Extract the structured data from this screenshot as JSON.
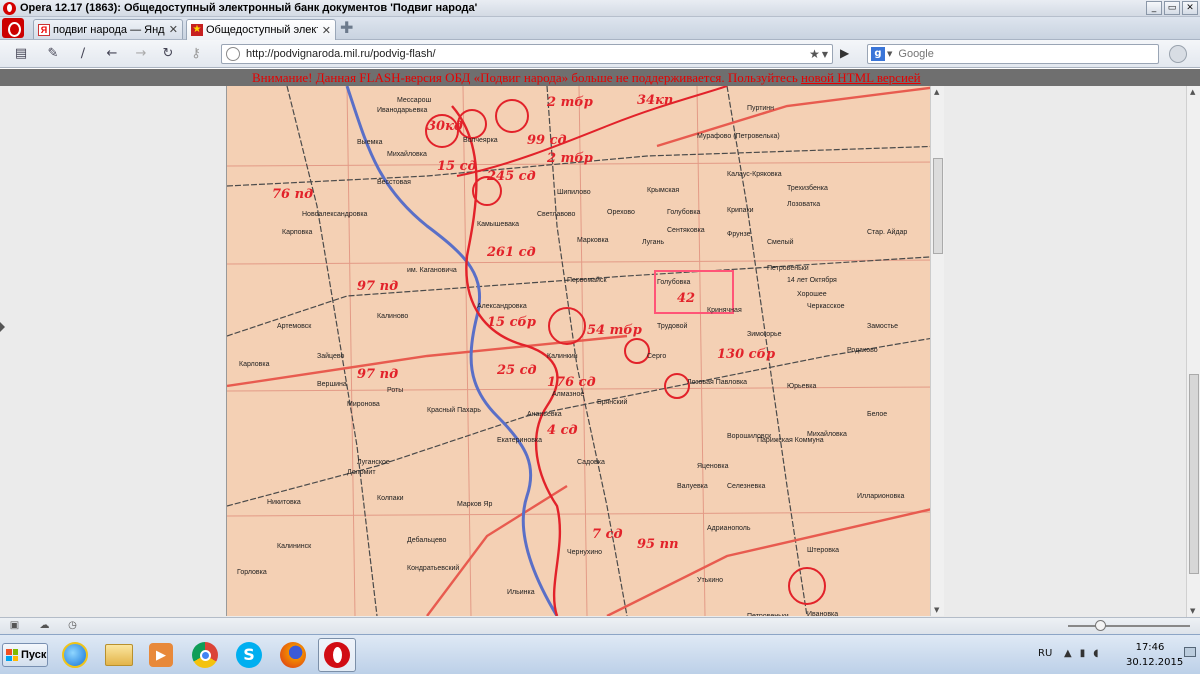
{
  "window": {
    "title": "Opera 12.17 (1863): Общедоступный электронный банк документов 'Подвиг народа'"
  },
  "tabs": [
    {
      "label": "подвиг народа — Янде...",
      "favicon": "yandex-icon",
      "active": false
    },
    {
      "label": "Общедоступный электр...",
      "favicon": "star-icon",
      "active": true
    }
  ],
  "toolbar": {
    "url": "http://podvignaroda.mil.ru/podvig-flash/",
    "search_placeholder": "Google"
  },
  "page": {
    "notice_text": "Внимание! Данная FLASH-версия ОБД «Подвиг народа» больше не поддерживается. Пользуйтесь ",
    "notice_link": "новой HTML версией"
  },
  "map": {
    "labels": [
      {
        "text": "Мессарош"
      },
      {
        "text": "Иванодарьевка"
      },
      {
        "text": "30кд"
      },
      {
        "text": "Волчеярка"
      },
      {
        "text": "2 тбр"
      },
      {
        "text": "34кп"
      },
      {
        "text": "Пуртинн"
      },
      {
        "text": "Выемка"
      },
      {
        "text": "99 сд"
      },
      {
        "text": "Мурафово (Петровелька)"
      },
      {
        "text": "Михайловка"
      },
      {
        "text": "15 сд"
      },
      {
        "text": "2 тбр"
      },
      {
        "text": "Калаус-Кряковка"
      },
      {
        "text": "76 пд"
      },
      {
        "text": "Весстовая"
      },
      {
        "text": "245 сд"
      },
      {
        "text": "Шипилово"
      },
      {
        "text": "Крымская"
      },
      {
        "text": "Трехизбенка"
      },
      {
        "text": "Новоалександровка"
      },
      {
        "text": "Светлавово"
      },
      {
        "text": "Орехово"
      },
      {
        "text": "Голубовка"
      },
      {
        "text": "Крипаки"
      },
      {
        "text": "Лозоватка"
      },
      {
        "text": "Стар. Айдар"
      },
      {
        "text": "Карповка"
      },
      {
        "text": "Камышевака"
      },
      {
        "text": "Марковка"
      },
      {
        "text": "Лугань"
      },
      {
        "text": "Сентяковка"
      },
      {
        "text": "Фрунзе"
      },
      {
        "text": "Смелый"
      },
      {
        "text": "261 сд"
      },
      {
        "text": "Первомайск"
      },
      {
        "text": "Голубовка"
      },
      {
        "text": "Петровеньки"
      },
      {
        "text": "14 лет Октября"
      },
      {
        "text": "им. Кагановича"
      },
      {
        "text": "97 пд"
      },
      {
        "text": "Александровка"
      },
      {
        "text": "42"
      },
      {
        "text": "Кринячная"
      },
      {
        "text": "Хорошее"
      },
      {
        "text": "Черкасское"
      },
      {
        "text": "Артемовск"
      },
      {
        "text": "Калиново"
      },
      {
        "text": "15 сбр"
      },
      {
        "text": "Трудовой"
      },
      {
        "text": "Замостье"
      },
      {
        "text": "Зимогорье"
      },
      {
        "text": "54 тбр"
      },
      {
        "text": "Калинкин"
      },
      {
        "text": "Сергo"
      },
      {
        "text": "130 сбр"
      },
      {
        "text": "Родаково"
      },
      {
        "text": "97 пд"
      },
      {
        "text": "Зайцево"
      },
      {
        "text": "25 сд"
      },
      {
        "text": "176 сд"
      },
      {
        "text": "Ворошиловск"
      },
      {
        "text": "Алмазное"
      },
      {
        "text": "Брянский"
      },
      {
        "text": "Лозовая Павловка"
      },
      {
        "text": "Юрьевка"
      },
      {
        "text": "Карловка"
      },
      {
        "text": "Вершина"
      },
      {
        "text": "Роты"
      },
      {
        "text": "Миронова"
      },
      {
        "text": "Красный Пахарь"
      },
      {
        "text": "Ананьевка"
      },
      {
        "text": "4 сд"
      },
      {
        "text": "Парижская Коммуна"
      },
      {
        "text": "Михайловка"
      },
      {
        "text": "Белое"
      },
      {
        "text": "Луганское"
      },
      {
        "text": "Екатериновка"
      },
      {
        "text": "Садовка"
      },
      {
        "text": "Яценовка"
      },
      {
        "text": "Валуевка"
      },
      {
        "text": "Доломит"
      },
      {
        "text": "Селезневка"
      },
      {
        "text": "Никитовка"
      },
      {
        "text": "Колпаки"
      },
      {
        "text": "Марков Яр"
      },
      {
        "text": "Адрианополь"
      },
      {
        "text": "Илларионовка"
      },
      {
        "text": "Калининск"
      },
      {
        "text": "Дебальцево"
      },
      {
        "text": "7 сд"
      },
      {
        "text": "95 пп"
      },
      {
        "text": "Чернухино"
      },
      {
        "text": "Штеровка"
      },
      {
        "text": "Горловка"
      },
      {
        "text": "Кондратьевский"
      },
      {
        "text": "Утькино"
      },
      {
        "text": "Ильинка"
      },
      {
        "text": "Петровеньки"
      },
      {
        "text": "Ивановка"
      }
    ]
  },
  "statusbar": {},
  "taskbar": {
    "start_label": "Пуск",
    "apps": [
      "ie-icon",
      "explorer-icon",
      "media-player-icon",
      "chrome-icon",
      "skype-icon",
      "firefox-icon",
      "opera-icon"
    ],
    "lang": "RU",
    "time": "17:46",
    "date": "30.12.2015"
  },
  "colors": {
    "map_bg": "#f4d0b4",
    "front_red": "#e2222a",
    "river_blue": "#5a6fc7",
    "notice_red": "#e60000"
  }
}
